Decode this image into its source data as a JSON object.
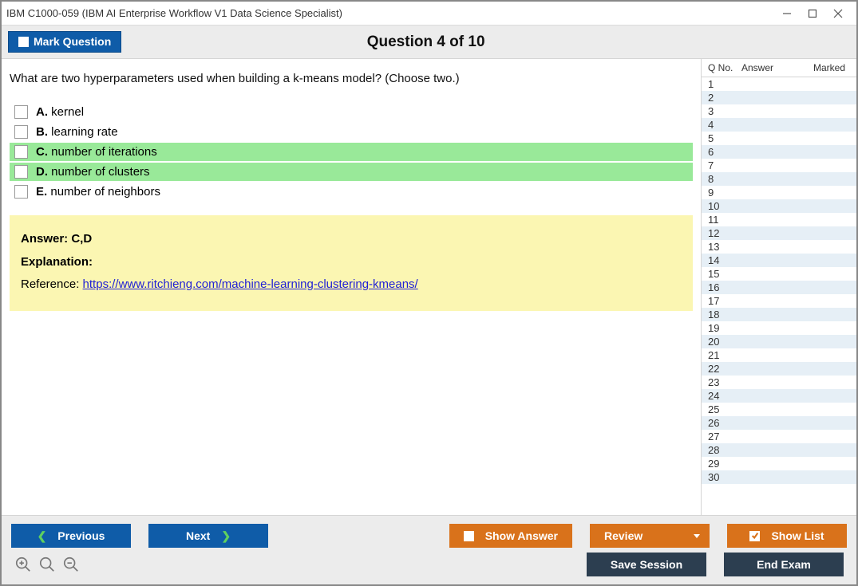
{
  "window": {
    "title": "IBM C1000-059 (IBM AI Enterprise Workflow V1 Data Science Specialist)"
  },
  "topbar": {
    "mark_label": "Mark Question",
    "counter": "Question 4 of 10"
  },
  "question": {
    "text": "What are two hyperparameters used when building a k-means model? (Choose two.)",
    "options": [
      {
        "letter": "A.",
        "text": "kernel",
        "highlight": false
      },
      {
        "letter": "B.",
        "text": "learning rate",
        "highlight": false
      },
      {
        "letter": "C.",
        "text": "number of iterations",
        "highlight": true
      },
      {
        "letter": "D.",
        "text": "number of clusters",
        "highlight": true
      },
      {
        "letter": "E.",
        "text": "number of neighbors",
        "highlight": false
      }
    ]
  },
  "answer": {
    "answer_label": "Answer: C,D",
    "explanation_label": "Explanation:",
    "reference_label": "Reference: ",
    "reference_url": "https://www.ritchieng.com/machine-learning-clustering-kmeans/"
  },
  "sidepanel": {
    "header": {
      "qno": "Q No.",
      "answer": "Answer",
      "marked": "Marked"
    },
    "rows": [
      1,
      2,
      3,
      4,
      5,
      6,
      7,
      8,
      9,
      10,
      11,
      12,
      13,
      14,
      15,
      16,
      17,
      18,
      19,
      20,
      21,
      22,
      23,
      24,
      25,
      26,
      27,
      28,
      29,
      30
    ]
  },
  "buttons": {
    "previous": "Previous",
    "next": "Next",
    "show_answer": "Show Answer",
    "review": "Review",
    "show_list": "Show List",
    "save_session": "Save Session",
    "end_exam": "End Exam"
  }
}
